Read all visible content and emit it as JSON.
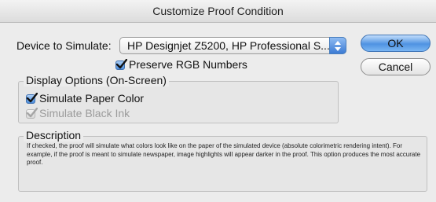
{
  "window": {
    "title": "Customize Proof Condition"
  },
  "device": {
    "label": "Device to Simulate:",
    "selected": "HP Designjet Z5200, HP Professional S..."
  },
  "preserve_rgb": {
    "label": "Preserve RGB Numbers",
    "checked": true
  },
  "buttons": {
    "ok": "OK",
    "cancel": "Cancel"
  },
  "display_options": {
    "title": "Display Options (On-Screen)",
    "simulate_paper": {
      "label": "Simulate Paper Color",
      "checked": true
    },
    "simulate_black": {
      "label": "Simulate Black Ink",
      "checked": true,
      "disabled": true
    }
  },
  "description": {
    "title": "Description",
    "text": "If checked, the proof will simulate what colors look like on the paper of the simulated device (absolute colorimetric rendering intent). For example, if the proof is meant to simulate newspaper, image highlights will appear darker in the proof. This option produces the most accurate proof."
  },
  "colors": {
    "accent": "#4f93e2",
    "window_bg": "#ececec",
    "disabled_text": "#9b9b9b"
  },
  "icons": {
    "popup": "updown-arrows-icon",
    "check": "checkmark-icon"
  }
}
